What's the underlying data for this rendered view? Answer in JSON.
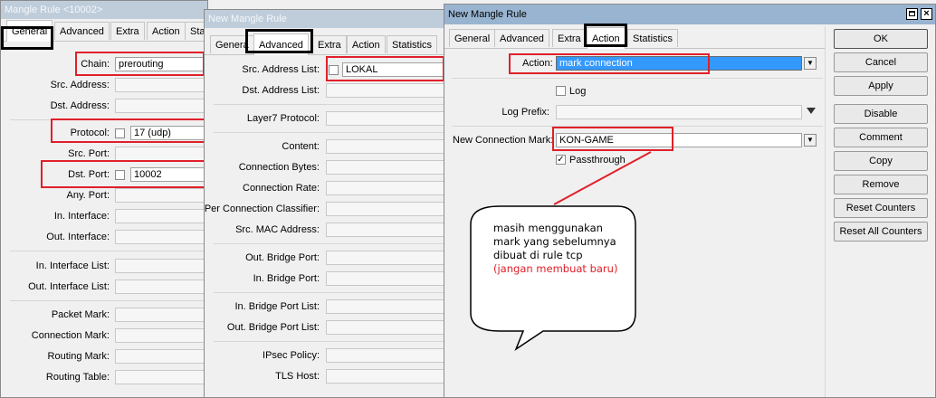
{
  "win1": {
    "title": "Mangle Rule <10002>",
    "tabs": [
      "General",
      "Advanced",
      "Extra",
      "Action",
      "Sta"
    ],
    "fields": {
      "chain_label": "Chain:",
      "chain_value": "prerouting",
      "src_address": "Src. Address:",
      "dst_address": "Dst. Address:",
      "protocol_label": "Protocol:",
      "protocol_value": "17 (udp)",
      "src_port": "Src. Port:",
      "dst_port_label": "Dst. Port:",
      "dst_port_value": "10002",
      "any_port": "Any. Port:",
      "in_interface": "In. Interface:",
      "out_interface": "Out. Interface:",
      "in_interface_list": "In. Interface List:",
      "out_interface_list": "Out. Interface List:",
      "packet_mark": "Packet Mark:",
      "connection_mark": "Connection Mark:",
      "routing_mark": "Routing Mark:",
      "routing_table": "Routing Table:"
    }
  },
  "win2": {
    "title": "New Mangle Rule",
    "tabs": [
      "Genera",
      "Advanced",
      "Extra",
      "Action",
      "Statistics"
    ],
    "fields": {
      "src_address_list_label": "Src. Address List:",
      "src_address_list_value": "LOKAL",
      "dst_address_list": "Dst. Address List:",
      "layer7": "Layer7 Protocol:",
      "content": "Content:",
      "connection_bytes": "Connection Bytes:",
      "connection_rate": "Connection Rate:",
      "per_connection_classifier": "Per Connection Classifier:",
      "src_mac": "Src. MAC Address:",
      "out_bridge_port": "Out. Bridge Port:",
      "in_bridge_port": "In. Bridge Port:",
      "in_bridge_port_list": "In. Bridge Port List:",
      "out_bridge_port_list": "Out. Bridge Port List:",
      "ipsec_policy": "IPsec Policy:",
      "tls_host": "TLS Host:"
    }
  },
  "win3": {
    "title": "New Mangle Rule",
    "tabs": [
      "General",
      "Advanced",
      "Extra",
      "Action",
      "Statistics"
    ],
    "action_label": "Action:",
    "action_value": "mark connection",
    "log_label": "Log",
    "log_prefix_label": "Log Prefix:",
    "new_conn_mark_label": "New Connection Mark:",
    "new_conn_mark_value": "KON-GAME",
    "passthrough_label": "Passthrough",
    "buttons": [
      "OK",
      "Cancel",
      "Apply",
      "Disable",
      "Comment",
      "Copy",
      "Remove",
      "Reset Counters",
      "Reset All Counters"
    ]
  },
  "callout": {
    "text_main": "masih menggunakan mark yang sebelumnya dibuat di rule tcp",
    "text_red": "(jangan membuat baru)"
  },
  "colors": {
    "highlight_red": "#e0202a",
    "selection_blue": "#3399ff",
    "callout_red_text": "#e0202a"
  }
}
